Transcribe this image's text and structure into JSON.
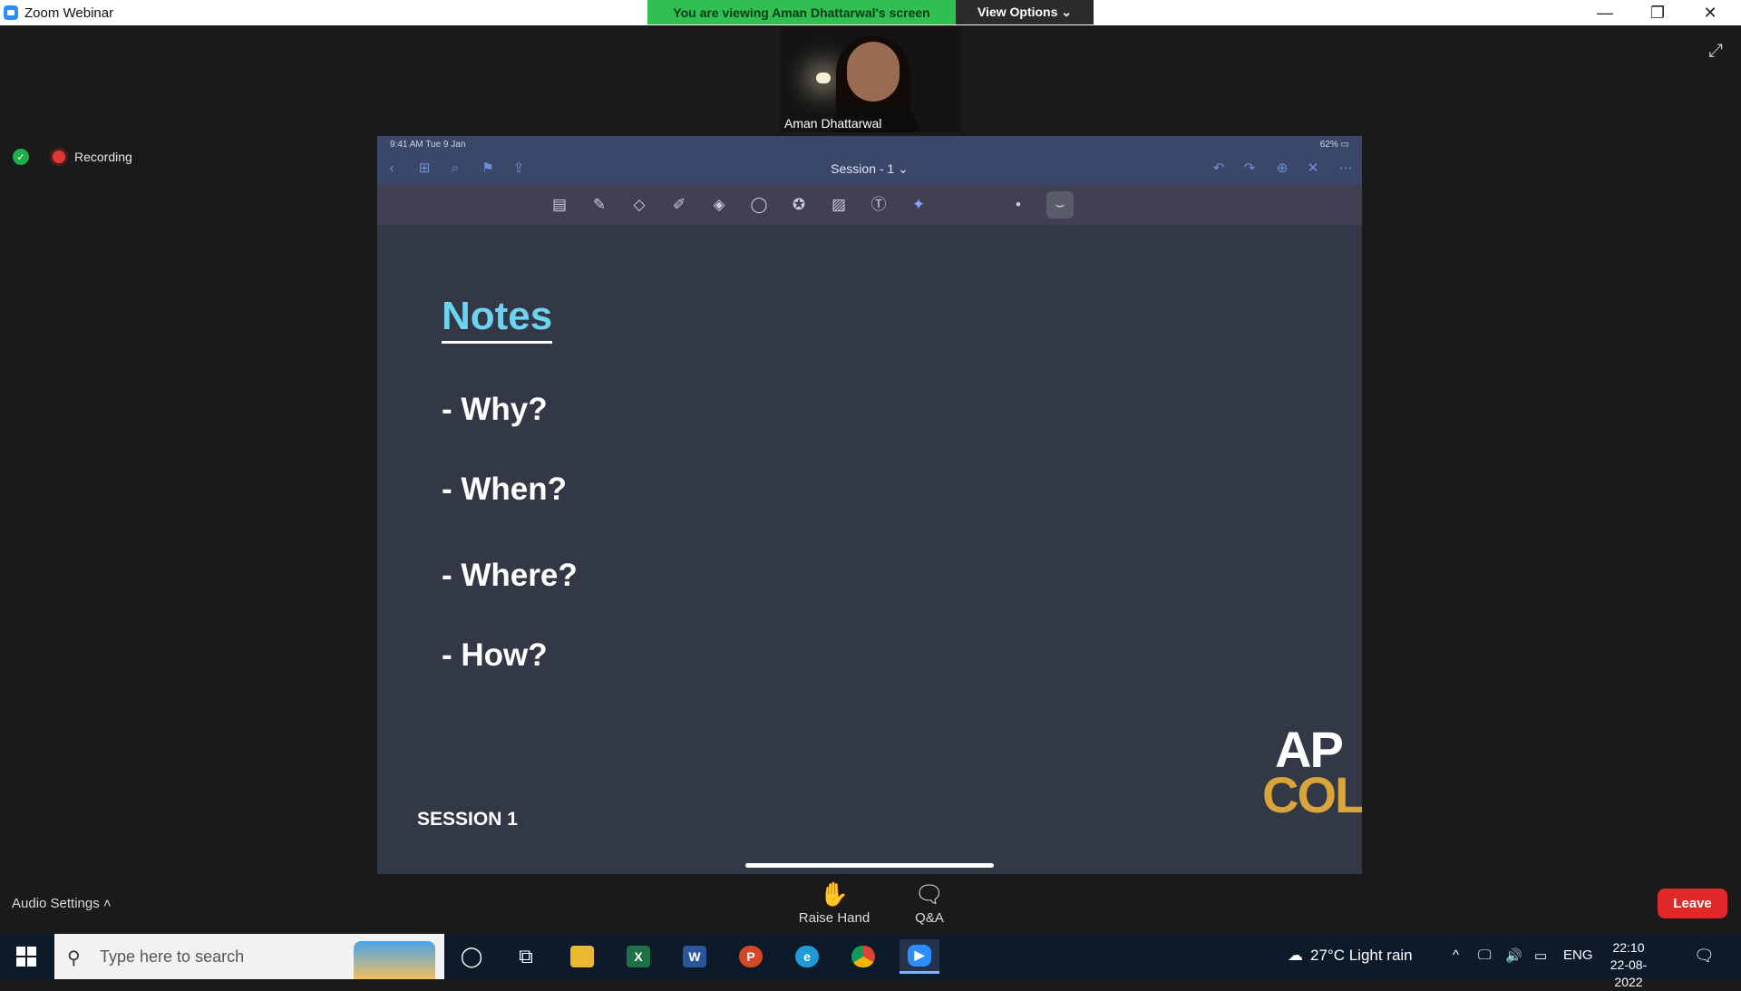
{
  "window": {
    "title": "Zoom Webinar",
    "banner": "You are viewing Aman Dhattarwal's screen",
    "view_options": "View Options ⌄",
    "minimize": "—",
    "restore": "❐",
    "close": "✕"
  },
  "video": {
    "name": "Aman Dhattarwal"
  },
  "status": {
    "recording": "Recording"
  },
  "ipad": {
    "time": "9:41 AM  Tue 9 Jan",
    "battery": "62%",
    "doc_title": "Session - 1 ⌄"
  },
  "slide": {
    "title": "Notes",
    "bullets": [
      "- Why?",
      "- When?",
      "- Where?",
      "- How?"
    ],
    "session": "SESSION 1",
    "brand_top": "AP",
    "brand_bottom": "COL"
  },
  "controls": {
    "audio_settings": "Audio Settings  ˄",
    "raise_hand": "Raise Hand",
    "qa": "Q&A",
    "leave": "Leave"
  },
  "taskbar": {
    "search_placeholder": "Type here to search",
    "weather": "27°C  Light rain",
    "language": "ENG",
    "time": "22:10",
    "date": "22-08-2022"
  }
}
